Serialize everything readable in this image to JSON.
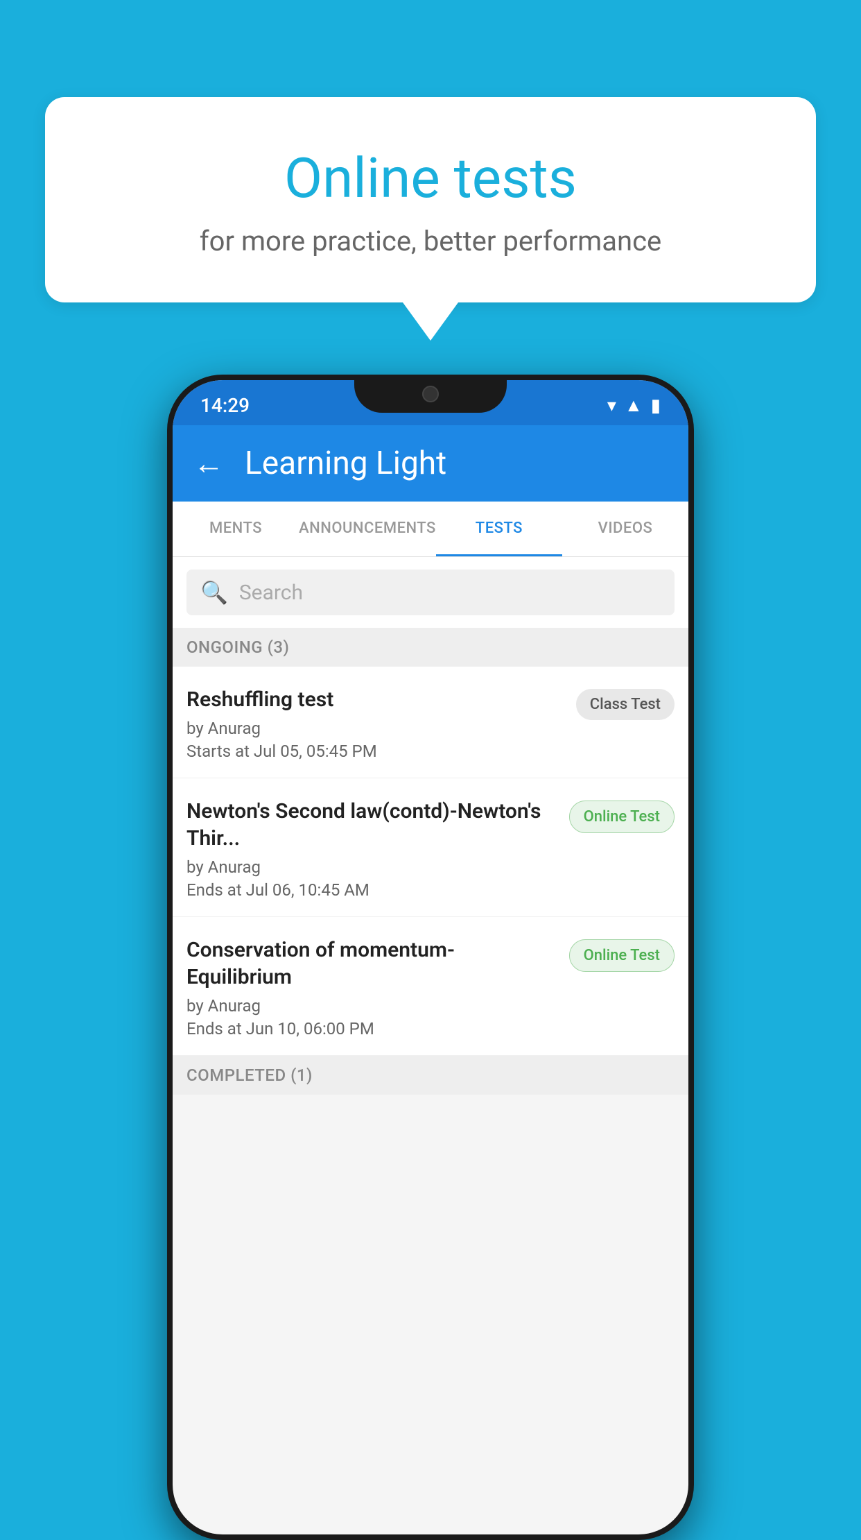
{
  "background_color": "#1AAFDC",
  "speech_bubble": {
    "title": "Online tests",
    "subtitle": "for more practice, better performance"
  },
  "status_bar": {
    "time": "14:29",
    "icons": [
      "wifi",
      "signal",
      "battery"
    ]
  },
  "app_bar": {
    "title": "Learning Light",
    "back_label": "←"
  },
  "tabs": [
    {
      "label": "MENTS",
      "active": false
    },
    {
      "label": "ANNOUNCEMENTS",
      "active": false
    },
    {
      "label": "TESTS",
      "active": true
    },
    {
      "label": "VIDEOS",
      "active": false
    }
  ],
  "search": {
    "placeholder": "Search"
  },
  "ongoing_section": {
    "label": "ONGOING (3)"
  },
  "tests": [
    {
      "name": "Reshuffling test",
      "author": "by Anurag",
      "date": "Starts at  Jul 05, 05:45 PM",
      "badge": "Class Test",
      "badge_type": "class"
    },
    {
      "name": "Newton's Second law(contd)-Newton's Thir...",
      "author": "by Anurag",
      "date": "Ends at  Jul 06, 10:45 AM",
      "badge": "Online Test",
      "badge_type": "online"
    },
    {
      "name": "Conservation of momentum-Equilibrium",
      "author": "by Anurag",
      "date": "Ends at  Jun 10, 06:00 PM",
      "badge": "Online Test",
      "badge_type": "online"
    }
  ],
  "completed_section": {
    "label": "COMPLETED (1)"
  }
}
